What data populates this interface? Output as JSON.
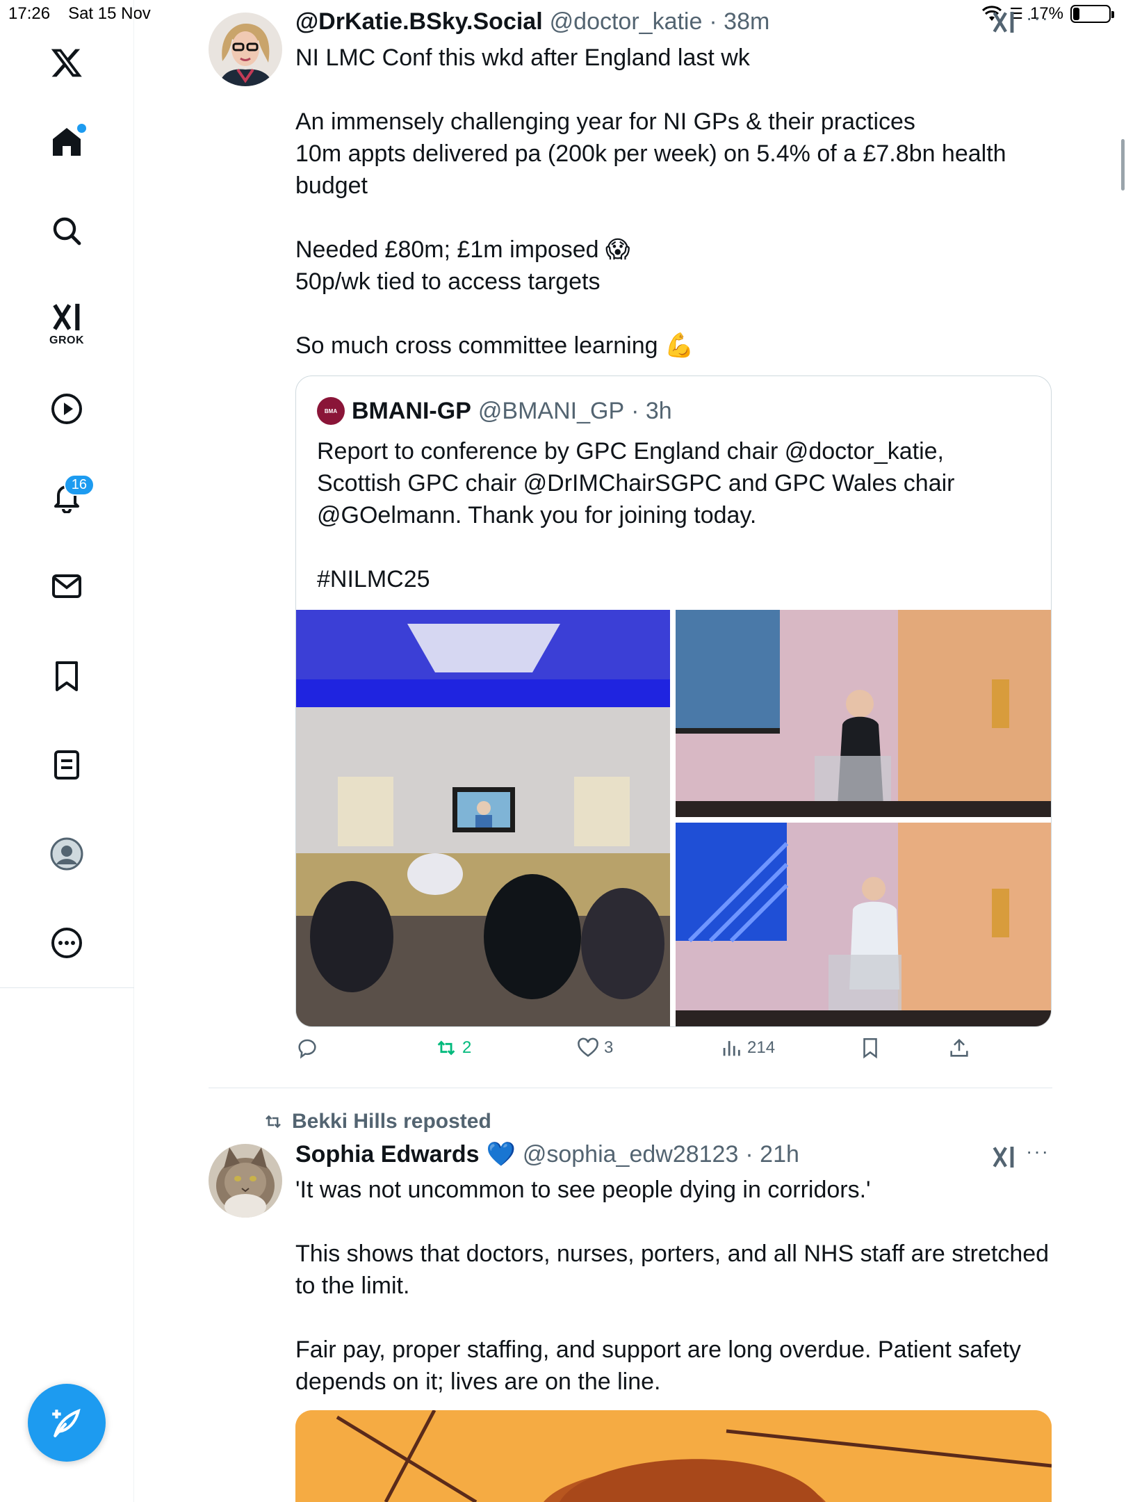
{
  "status_bar": {
    "time": "17:26",
    "date": "Sat 15 Nov",
    "battery": "17%",
    "battery_level": 0.17
  },
  "sidebar": {
    "items": [
      {
        "name": "x-logo-icon"
      },
      {
        "name": "home-icon",
        "has_dot": true
      },
      {
        "name": "search-icon"
      },
      {
        "name": "grok-icon",
        "label": "GROK"
      },
      {
        "name": "video-icon"
      },
      {
        "name": "notifications-icon",
        "badge": "16"
      },
      {
        "name": "messages-icon"
      },
      {
        "name": "bookmarks-icon"
      },
      {
        "name": "lists-icon"
      },
      {
        "name": "profile-icon"
      },
      {
        "name": "more-icon"
      }
    ],
    "compose_icon": "compose-icon",
    "accent": "#1d9bf0"
  },
  "tweet1": {
    "name": "@DrKatie.BSky.Social",
    "handle": "@doctor_katie",
    "time": "· 38m",
    "body": "NI LMC Conf this wkd after England last wk\n\nAn immensely challenging year for NI GPs & their practices\n10m appts delivered pa (200k per week) on 5.4% of a £7.8bn health budget\n\nNeeded £80m; £1m imposed 😱\n50p/wk tied to access targets\n\nSo much cross committee learning 💪",
    "quote": {
      "avatar_text": "BMA",
      "name": "BMANI-GP",
      "handle": "@BMANI_GP",
      "time": "· 3h",
      "body": "Report to conference by GPC England chair @doctor_katie, Scottish GPC chair @DrIMChairSGPC and GPC Wales chair @GOelmann. Thank you for joining today.\n\n#NILMC25"
    },
    "actions": {
      "reply": "",
      "reposts": "2",
      "likes": "3",
      "views": "214",
      "repost_color": "#00ba7c"
    }
  },
  "tweet2": {
    "reposted_by": "Bekki Hills reposted",
    "name": "Sophia Edwards",
    "badge_emoji": "💙",
    "handle": "@sophia_edw28123",
    "time": "· 21h",
    "body": "'It was not uncommon to see people dying in corridors.'\n\nThis shows that doctors, nurses, porters, and all NHS staff are stretched to the limit.\n\nFair pay, proper staffing, and support are long overdue. Patient safety depends on it; lives are on the line."
  }
}
